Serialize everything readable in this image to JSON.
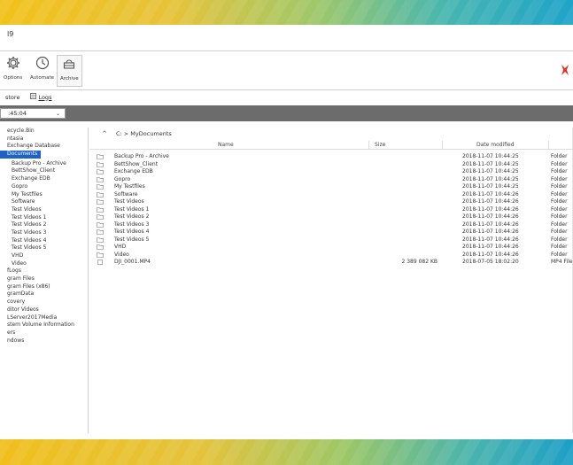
{
  "window": {
    "title": "l9"
  },
  "toolbar": {
    "buttons": [
      {
        "label": "Options",
        "icon": "gear-icon"
      },
      {
        "label": "Automate",
        "icon": "clock-icon"
      },
      {
        "label": "Archive",
        "icon": "archive-icon"
      }
    ],
    "run_icon": "red-star-icon"
  },
  "tabs": [
    {
      "label": "store",
      "icon": ""
    },
    {
      "label": "Logs",
      "icon": "logs-icon"
    }
  ],
  "time_selector": {
    "value": ":45:04"
  },
  "tree": {
    "items": [
      {
        "label": "ecycle.Bin",
        "child": false,
        "selected": false
      },
      {
        "label": "ntasia",
        "child": false,
        "selected": false
      },
      {
        "label": "Exchange Database",
        "child": false,
        "selected": false
      },
      {
        "label": "Documents",
        "child": false,
        "selected": true
      },
      {
        "label": "Backup Pro - Archive",
        "child": true,
        "selected": false
      },
      {
        "label": "BettShow_Client",
        "child": true,
        "selected": false
      },
      {
        "label": "Exchange EDB",
        "child": true,
        "selected": false
      },
      {
        "label": "Gopro",
        "child": true,
        "selected": false
      },
      {
        "label": "My Testfiles",
        "child": true,
        "selected": false
      },
      {
        "label": "Software",
        "child": true,
        "selected": false
      },
      {
        "label": "Test Videos",
        "child": true,
        "selected": false
      },
      {
        "label": "Test Videos 1",
        "child": true,
        "selected": false
      },
      {
        "label": "Test Videos 2",
        "child": true,
        "selected": false
      },
      {
        "label": "Test Videos 3",
        "child": true,
        "selected": false
      },
      {
        "label": "Test Videos 4",
        "child": true,
        "selected": false
      },
      {
        "label": "Test Videos 5",
        "child": true,
        "selected": false
      },
      {
        "label": "VHD",
        "child": true,
        "selected": false
      },
      {
        "label": "Video",
        "child": true,
        "selected": false
      },
      {
        "label": "fLogs",
        "child": false,
        "selected": false
      },
      {
        "label": "gram Files",
        "child": false,
        "selected": false
      },
      {
        "label": "gram Files (x86)",
        "child": false,
        "selected": false
      },
      {
        "label": "gramData",
        "child": false,
        "selected": false
      },
      {
        "label": "covery",
        "child": false,
        "selected": false
      },
      {
        "label": "ditor Videos",
        "child": false,
        "selected": false
      },
      {
        "label": "LServer2017Media",
        "child": false,
        "selected": false
      },
      {
        "label": "stem Volume Information",
        "child": false,
        "selected": false
      },
      {
        "label": "ers",
        "child": false,
        "selected": false
      },
      {
        "label": "ndows",
        "child": false,
        "selected": false
      }
    ]
  },
  "path": {
    "up_symbol": "^",
    "crumbs": "C:  >  MyDocuments"
  },
  "columns": {
    "name": "Name",
    "size": "Size",
    "date": "Date modified"
  },
  "files": [
    {
      "name": "Backup Pro - Archive",
      "size": "",
      "date": "2018-11-07  10:44:25",
      "type": "Folder",
      "kind": "folder"
    },
    {
      "name": "BettShow_Client",
      "size": "",
      "date": "2018-11-07  10:44:25",
      "type": "Folder",
      "kind": "folder"
    },
    {
      "name": "Exchange EDB",
      "size": "",
      "date": "2018-11-07  10:44:25",
      "type": "Folder",
      "kind": "folder"
    },
    {
      "name": "Gopro",
      "size": "",
      "date": "2018-11-07  10:44:25",
      "type": "Folder",
      "kind": "folder"
    },
    {
      "name": "My Testfiles",
      "size": "",
      "date": "2018-11-07  10:44:25",
      "type": "Folder",
      "kind": "folder"
    },
    {
      "name": "Software",
      "size": "",
      "date": "2018-11-07  10:44:26",
      "type": "Folder",
      "kind": "folder"
    },
    {
      "name": "Test Videos",
      "size": "",
      "date": "2018-11-07  10:44:26",
      "type": "Folder",
      "kind": "folder"
    },
    {
      "name": "Test Videos 1",
      "size": "",
      "date": "2018-11-07  10:44:26",
      "type": "Folder",
      "kind": "folder"
    },
    {
      "name": "Test Videos 2",
      "size": "",
      "date": "2018-11-07  10:44:26",
      "type": "Folder",
      "kind": "folder"
    },
    {
      "name": "Test Videos 3",
      "size": "",
      "date": "2018-11-07  10:44:26",
      "type": "Folder",
      "kind": "folder"
    },
    {
      "name": "Test Videos 4",
      "size": "",
      "date": "2018-11-07  10:44:26",
      "type": "Folder",
      "kind": "folder"
    },
    {
      "name": "Test Videos 5",
      "size": "",
      "date": "2018-11-07  10:44:26",
      "type": "Folder",
      "kind": "folder"
    },
    {
      "name": "VHD",
      "size": "",
      "date": "2018-11-07  10:44:26",
      "type": "Folder",
      "kind": "folder"
    },
    {
      "name": "Video",
      "size": "",
      "date": "2018-11-07  10:44:26",
      "type": "Folder",
      "kind": "folder"
    },
    {
      "name": "DJI_0001.MP4",
      "size": "2 389 082 KB",
      "date": "2018-07-05  18:02:20",
      "type": "MP4 File",
      "kind": "file"
    }
  ],
  "colors": {
    "selection": "#1e62c6",
    "darkbar": "#6c6c6c",
    "run_icon": "#d9352b"
  }
}
